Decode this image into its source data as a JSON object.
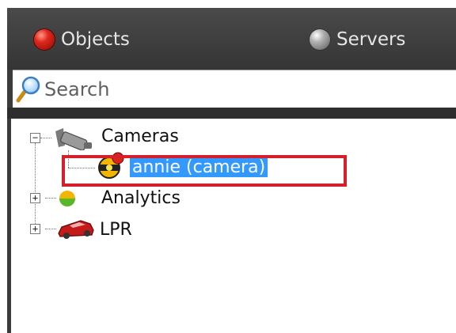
{
  "tabs": {
    "objects_label": "Objects",
    "servers_label": "Servers"
  },
  "search": {
    "placeholder": "Search"
  },
  "tree": {
    "cameras_label": "Cameras",
    "camera_item_label": "annie (camera)",
    "analytics_label": "Analytics",
    "lpr_label": "LPR"
  },
  "colors": {
    "selection": "#3399ff",
    "highlight_border": "#d3202a",
    "objects_orb": "#e0281c",
    "servers_orb": "#b0b0b0"
  },
  "icons": {
    "objects": "red-orb-icon",
    "servers": "grey-orb-icon",
    "search": "magnifier-icon",
    "cameras": "security-camera-icon",
    "camera_item": "camera-status-icon",
    "analytics": "analytics-icon",
    "lpr": "car-icon"
  }
}
